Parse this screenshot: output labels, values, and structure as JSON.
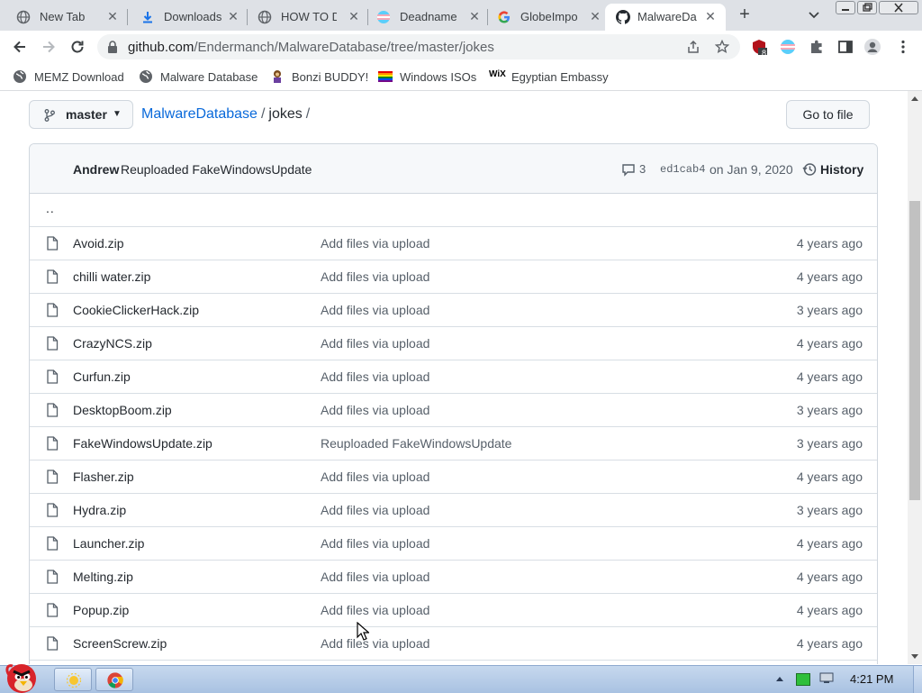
{
  "browser": {
    "tabs": [
      {
        "title": "New Tab",
        "active": false
      },
      {
        "title": "Downloads",
        "active": false
      },
      {
        "title": "HOW TO DD",
        "active": false
      },
      {
        "title": "Deadname",
        "active": false
      },
      {
        "title": "GlobeImpo",
        "active": false
      },
      {
        "title": "MalwareDa",
        "active": true
      }
    ],
    "tab_close_glyph": "✕",
    "new_tab_glyph": "+",
    "url_host": "github.com",
    "url_path": "/Endermanch/MalwareDatabase/tree/master/jokes",
    "extension_badge": "8",
    "bookmarks": [
      {
        "label": "MEMZ Download",
        "icon": "globe-icon"
      },
      {
        "label": "Malware Database",
        "icon": "globe-icon"
      },
      {
        "label": "Bonzi BUDDY!",
        "icon": "bonzi-icon"
      },
      {
        "label": "Windows ISOs",
        "icon": "rainbow-flag-icon"
      },
      {
        "label": "Egyptian Embassy",
        "icon": "wix-icon"
      }
    ],
    "wix_text": "WiX"
  },
  "repo": {
    "branch": "master",
    "repo_name": "MalwareDatabase",
    "separator": "/",
    "current_dir": "jokes",
    "go_to_file_label": "Go to file",
    "latest_commit": {
      "author": "Andrew",
      "message": "Reuploaded FakeWindowsUpdate",
      "comment_count": "3",
      "sha": "ed1cab4",
      "date": "on Jan 9, 2020",
      "history_label": "History"
    },
    "parent_dir_label": "..",
    "files": [
      {
        "name": "Avoid.zip",
        "message": "Add files via upload",
        "age": "4 years ago"
      },
      {
        "name": "chilli water.zip",
        "message": "Add files via upload",
        "age": "4 years ago"
      },
      {
        "name": "CookieClickerHack.zip",
        "message": "Add files via upload",
        "age": "3 years ago"
      },
      {
        "name": "CrazyNCS.zip",
        "message": "Add files via upload",
        "age": "4 years ago"
      },
      {
        "name": "Curfun.zip",
        "message": "Add files via upload",
        "age": "4 years ago"
      },
      {
        "name": "DesktopBoom.zip",
        "message": "Add files via upload",
        "age": "3 years ago"
      },
      {
        "name": "FakeWindowsUpdate.zip",
        "message": "Reuploaded FakeWindowsUpdate",
        "age": "3 years ago"
      },
      {
        "name": "Flasher.zip",
        "message": "Add files via upload",
        "age": "4 years ago"
      },
      {
        "name": "Hydra.zip",
        "message": "Add files via upload",
        "age": "3 years ago"
      },
      {
        "name": "Launcher.zip",
        "message": "Add files via upload",
        "age": "4 years ago"
      },
      {
        "name": "Melting.zip",
        "message": "Add files via upload",
        "age": "4 years ago"
      },
      {
        "name": "Popup.zip",
        "message": "Add files via upload",
        "age": "4 years ago"
      },
      {
        "name": "ScreenScrew.zip",
        "message": "Add files via upload",
        "age": "4 years ago"
      }
    ]
  },
  "taskbar": {
    "clock": "4:21 PM"
  },
  "colors": {
    "link_blue": "#0969da",
    "tab_strip": "#dee1e6",
    "border": "#d0d7de",
    "muted_text": "#57606a",
    "taskbar": "#b9cde8"
  }
}
